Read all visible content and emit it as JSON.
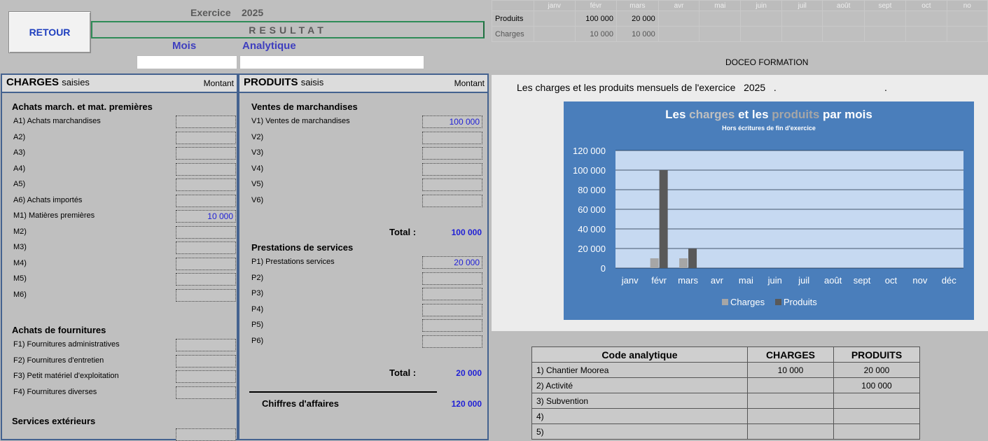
{
  "top": {
    "retour": "RETOUR",
    "exercice_label": "Exercice",
    "exercice_year": "2025",
    "resultat": "RESULTAT",
    "mois_label": "Mois",
    "analytique_label": "Analytique"
  },
  "months_table": {
    "months": [
      "janv",
      "févr",
      "mars",
      "avr",
      "mai",
      "juin",
      "juil",
      "août",
      "sept",
      "oct",
      "no"
    ],
    "produits_label": "Produits",
    "produits": [
      "",
      "100 000",
      "20 000",
      "",
      "",
      "",
      "",
      "",
      "",
      "",
      ""
    ],
    "charges_label": "Charges",
    "charges": [
      "",
      "10 000",
      "10 000",
      "",
      "",
      "",
      "",
      "",
      "",
      "",
      ""
    ]
  },
  "company": "DOCEO FORMATION",
  "charges_panel": {
    "title": "CHARGES",
    "title_small": "saisies",
    "montant": "Montant",
    "sections": [
      {
        "title": "Achats march. et mat. premières",
        "rows": [
          {
            "label": "A1) Achats marchandises",
            "value": ""
          },
          {
            "label": "A2)",
            "value": ""
          },
          {
            "label": "A3)",
            "value": ""
          },
          {
            "label": "A4)",
            "value": ""
          },
          {
            "label": "A5)",
            "value": ""
          },
          {
            "label": "A6) Achats importés",
            "value": ""
          },
          {
            "label": "M1) Matières premières",
            "value": "10 000"
          },
          {
            "label": "M2)",
            "value": ""
          },
          {
            "label": "M3)",
            "value": ""
          },
          {
            "label": "M4)",
            "value": ""
          },
          {
            "label": "M5)",
            "value": ""
          },
          {
            "label": "M6)",
            "value": ""
          }
        ]
      },
      {
        "title": "Achats de fournitures",
        "rows": [
          {
            "label": "F1) Fournitures administratives",
            "value": ""
          },
          {
            "label": "F2) Fournitures d'entretien",
            "value": ""
          },
          {
            "label": "F3) Petit matériel d'exploitation",
            "value": ""
          },
          {
            "label": "F4) Fournitures diverses",
            "value": ""
          }
        ]
      },
      {
        "title": "Services extérieurs",
        "rows": []
      }
    ]
  },
  "produits_panel": {
    "title": "PRODUITS",
    "title_small": "saisis",
    "montant": "Montant",
    "ventes": {
      "title": "Ventes de marchandises",
      "rows": [
        {
          "label": "V1) Ventes de marchandises",
          "value": "100 000"
        },
        {
          "label": "V2)",
          "value": ""
        },
        {
          "label": "V3)",
          "value": ""
        },
        {
          "label": "V4)",
          "value": ""
        },
        {
          "label": "V5)",
          "value": ""
        },
        {
          "label": "V6)",
          "value": ""
        }
      ],
      "total_label": "Total :",
      "total": "100 000"
    },
    "prestations": {
      "title": "Prestations de services",
      "rows": [
        {
          "label": "P1) Prestations services",
          "value": "20 000"
        },
        {
          "label": "P2)",
          "value": ""
        },
        {
          "label": "P3)",
          "value": ""
        },
        {
          "label": "P4)",
          "value": ""
        },
        {
          "label": "P5)",
          "value": ""
        },
        {
          "label": "P6)",
          "value": ""
        }
      ],
      "total_label": "Total :",
      "total": "20 000"
    },
    "ca_label": "Chiffres d'affaires",
    "ca_value": "120 000"
  },
  "caption": {
    "text": "Les charges et les produits mensuels de l'exercice",
    "year": "2025",
    "dot1": ".",
    "dot2": "."
  },
  "chart_data": {
    "type": "bar",
    "title_parts": [
      "Les ",
      "charges",
      " et les ",
      "produits",
      " par mois"
    ],
    "subtitle": "Hors écritures de fin d'exercice",
    "categories": [
      "janv",
      "févr",
      "mars",
      "avr",
      "mai",
      "juin",
      "juil",
      "août",
      "sept",
      "oct",
      "nov",
      "déc"
    ],
    "series": [
      {
        "name": "Charges",
        "values": [
          0,
          10000,
          10000,
          0,
          0,
          0,
          0,
          0,
          0,
          0,
          0,
          0
        ],
        "color": "#a6a6a6"
      },
      {
        "name": "Produits",
        "values": [
          0,
          100000,
          20000,
          0,
          0,
          0,
          0,
          0,
          0,
          0,
          0,
          0
        ],
        "color": "#595959"
      }
    ],
    "ylim": [
      0,
      120000
    ],
    "yticks": [
      "0",
      "20 000",
      "40 000",
      "60 000",
      "80 000",
      "100 000",
      "120 000"
    ],
    "grid": true,
    "legend": "bottom",
    "colors": {
      "background": "#4a7ebb",
      "plot": "#c6d9f1",
      "title_charges": "#bfbfbf",
      "title_produits": "#a6a6a6"
    }
  },
  "analytic_table": {
    "headers": [
      "Code analytique",
      "CHARGES",
      "PRODUITS"
    ],
    "rows": [
      {
        "label": "1) Chantier Moorea",
        "charges": "10 000",
        "produits": "20 000"
      },
      {
        "label": "2) Activité",
        "charges": "",
        "produits": "100 000"
      },
      {
        "label": "3) Subvention",
        "charges": "",
        "produits": ""
      },
      {
        "label": "4)",
        "charges": "",
        "produits": ""
      },
      {
        "label": "5)",
        "charges": "",
        "produits": ""
      }
    ]
  }
}
